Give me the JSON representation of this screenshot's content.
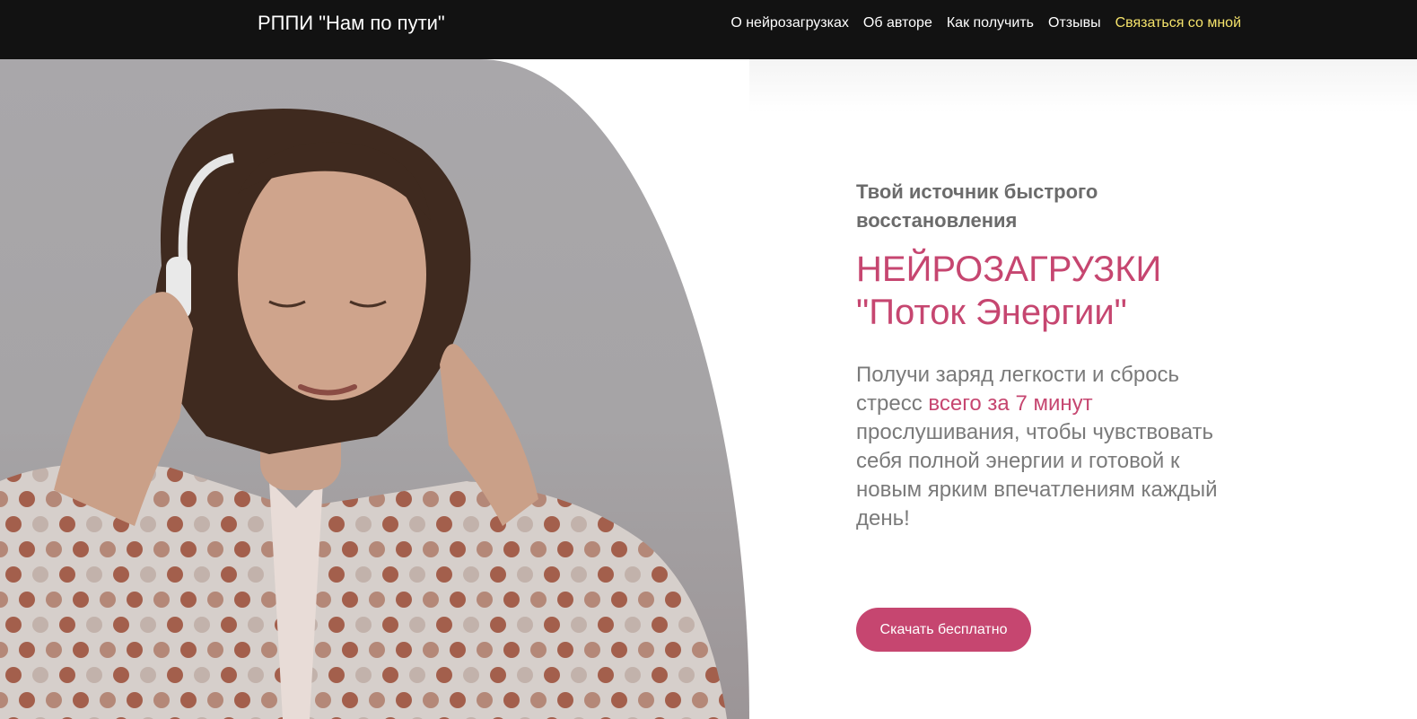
{
  "header": {
    "brand": "РППИ \"Нам по пути\"",
    "nav": [
      {
        "label": "О нейрозагрузках"
      },
      {
        "label": "Об авторе"
      },
      {
        "label": "Как получить"
      },
      {
        "label": "Отзывы"
      },
      {
        "label": "Связаться со мной"
      }
    ]
  },
  "hero": {
    "kicker": "Твой источник быстрого восстановления",
    "headline_line1": "НЕЙРОЗАГРУЗКИ",
    "headline_line2": "\"Поток Энергии\"",
    "desc_before": "Получи заряд легкости и сбрось стресс ",
    "desc_highlight": "всего за 7 минут",
    "desc_after": " прослушивания, чтобы чувствовать себя полной энергии и готовой к новым ярким впечатлениям каждый день!",
    "cta_label": "Скачать бесплатно"
  },
  "colors": {
    "header_bg": "#121212",
    "accent": "#c64670",
    "nav_accent": "#f5e36b"
  }
}
